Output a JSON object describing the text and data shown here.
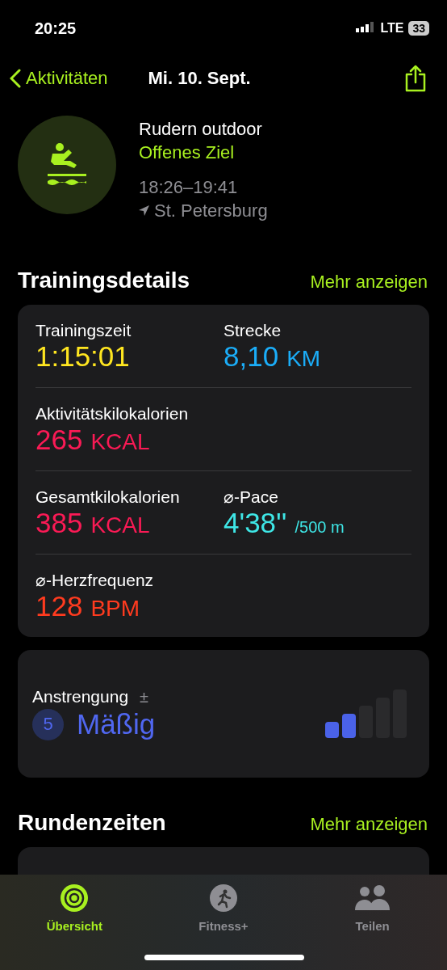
{
  "status_bar": {
    "time": "20:25",
    "network": "LTE",
    "battery": "33"
  },
  "nav": {
    "back": "Aktivitäten",
    "title": "Mi. 10. Sept."
  },
  "workout": {
    "name": "Rudern outdoor",
    "goal": "Offenes Ziel",
    "time": "18:26–19:41",
    "location": "St. Petersburg"
  },
  "details": {
    "title": "Trainingsdetails",
    "more": "Mehr anzeigen",
    "rows": [
      [
        {
          "label": "Trainingszeit",
          "value": "1:15:01",
          "color": "#ffe620"
        },
        {
          "label": "Strecke",
          "value": "8,10",
          "unit": "KM",
          "color": "#1badf8"
        }
      ],
      [
        {
          "label": "Aktivitätskilokalorien",
          "value": "265",
          "unit": "KCAL",
          "color": "#fa1a55"
        }
      ],
      [
        {
          "label": "Gesamtkilokalorien",
          "value": "385",
          "unit": "KCAL",
          "color": "#fa1a55"
        },
        {
          "label": "⌀-Pace",
          "value": "4'38''",
          "per": "/500 m",
          "color": "#3ee6e6"
        }
      ],
      [
        {
          "label": "⌀-Herzfrequenz",
          "value": "128",
          "unit": "BPM",
          "color": "#ff3b1f"
        }
      ]
    ]
  },
  "effort": {
    "label": "Anstrengung",
    "adjust": "±",
    "score": "5",
    "rating": "Mäßig",
    "level": 0.4
  },
  "laps": {
    "title": "Rundenzeiten",
    "more": "Mehr anzeigen"
  },
  "tab_bar": [
    {
      "label": "Übersicht",
      "selected": true
    },
    {
      "label": "Fitness+",
      "selected": false
    },
    {
      "label": "Teilen",
      "selected": false
    }
  ]
}
